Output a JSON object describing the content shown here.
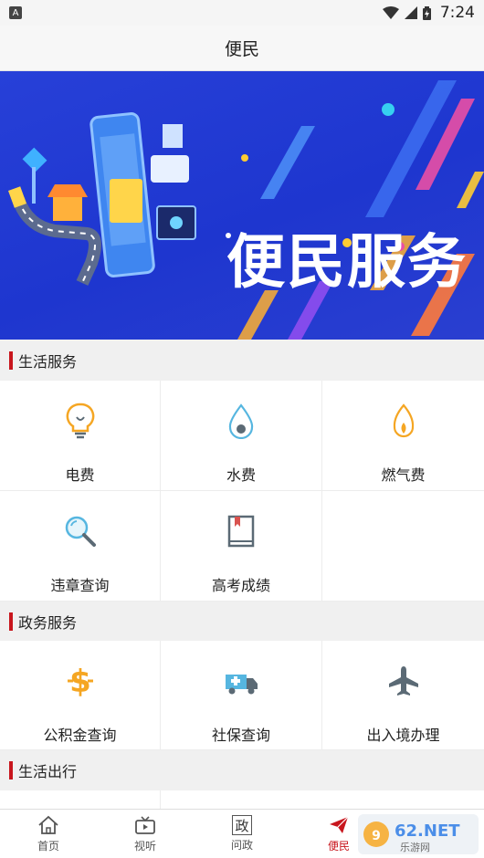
{
  "status": {
    "time": "7:24"
  },
  "header": {
    "title": "便民"
  },
  "banner": {
    "title": "便民服务"
  },
  "sections": [
    {
      "title": "生活服务",
      "items": [
        {
          "label": "电费",
          "icon": "lightbulb-icon"
        },
        {
          "label": "水费",
          "icon": "water-drop-icon"
        },
        {
          "label": "燃气费",
          "icon": "gas-flame-icon"
        },
        {
          "label": "违章查询",
          "icon": "magnifier-icon"
        },
        {
          "label": "高考成绩",
          "icon": "book-icon"
        }
      ]
    },
    {
      "title": "政务服务",
      "items": [
        {
          "label": "公积金查询",
          "icon": "dollar-icon"
        },
        {
          "label": "社保查询",
          "icon": "ambulance-icon"
        },
        {
          "label": "出入境办理",
          "icon": "airplane-icon"
        }
      ]
    },
    {
      "title": "生活出行",
      "items": []
    }
  ],
  "bottom_nav": [
    {
      "label": "首页",
      "icon": "home-icon"
    },
    {
      "label": "视听",
      "icon": "tv-icon"
    },
    {
      "label": "问政",
      "icon": "zheng-icon",
      "glyph": "政"
    },
    {
      "label": "便民",
      "icon": "paper-plane-icon"
    }
  ],
  "colors": {
    "accent": "#c8161d",
    "banner_blue": "#2740d8",
    "icon_orange": "#f5a623",
    "icon_gray": "#5b6a75"
  }
}
